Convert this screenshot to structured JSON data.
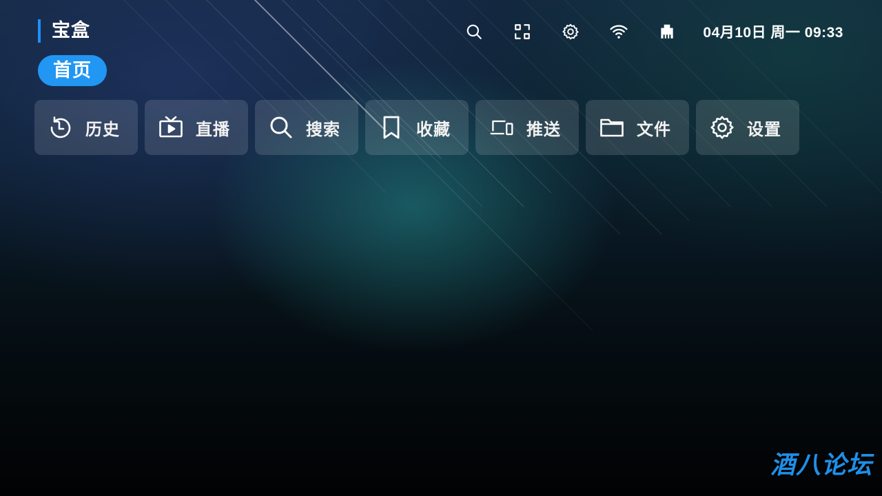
{
  "header": {
    "title": "宝盒",
    "active_tab": "首页",
    "datetime": "04月10日 周一 09:33",
    "icons": [
      "search-icon",
      "qr-scan-icon",
      "gear-icon",
      "wifi-icon",
      "ethernet-icon"
    ]
  },
  "menu": {
    "items": [
      {
        "label": "历史",
        "icon": "history-icon"
      },
      {
        "label": "直播",
        "icon": "tv-icon"
      },
      {
        "label": "搜索",
        "icon": "search-icon"
      },
      {
        "label": "收藏",
        "icon": "bookmark-icon"
      },
      {
        "label": "推送",
        "icon": "devices-icon"
      },
      {
        "label": "文件",
        "icon": "folder-icon"
      },
      {
        "label": "设置",
        "icon": "gear-icon"
      }
    ]
  },
  "watermark": "酒八论坛",
  "colors": {
    "accent": "#2196f3",
    "title_bar": "#1e90ff",
    "watermark": "#1f8fe8"
  }
}
